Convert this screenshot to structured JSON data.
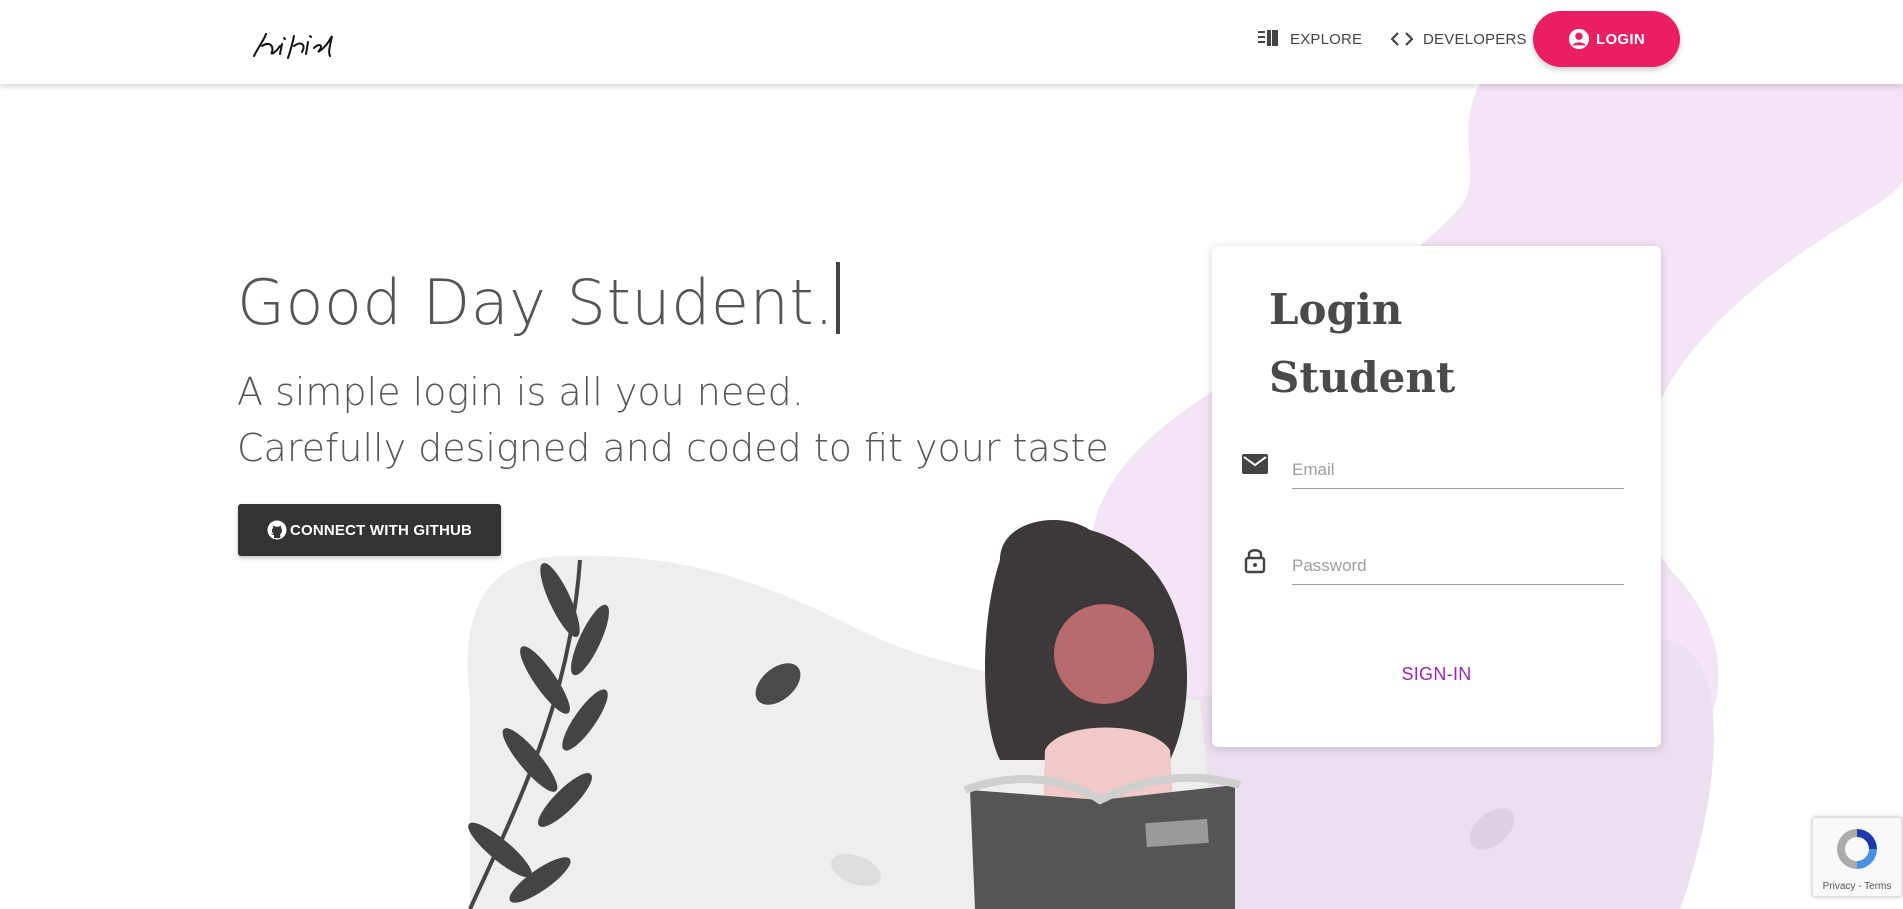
{
  "nav": {
    "logo_alt": "signature-logo",
    "explore_label": "EXPLORE",
    "developers_label": "DEVELOPERS",
    "login_label": "LOGIN"
  },
  "hero": {
    "title": "Good Day Student.",
    "subtitle_line1": "A simple login is all you need.",
    "subtitle_line2": "Carefully designed and coded to fit your taste",
    "github_button": "CONNECT WITH GITHUB"
  },
  "login_card": {
    "title_line1": "Login",
    "title_line2": "Student",
    "email_placeholder": "Email",
    "email_value": "",
    "password_placeholder": "Password",
    "password_value": "",
    "signin_label": "SIGN-IN"
  },
  "recaptcha": {
    "links": "Privacy - Terms"
  },
  "colors": {
    "accent_pink": "#e91e63",
    "signin_purple": "#9c27b0",
    "github_dark": "#333333",
    "blob_lavender": "#f3e5f5",
    "blob_gray": "#eeeeee"
  },
  "icons": {
    "explore": "list-book-icon",
    "developers": "code-brackets-icon",
    "login": "account-circle-icon",
    "github": "github-icon",
    "email": "mail-icon",
    "password": "lock-icon",
    "recaptcha": "recaptcha-icon"
  }
}
